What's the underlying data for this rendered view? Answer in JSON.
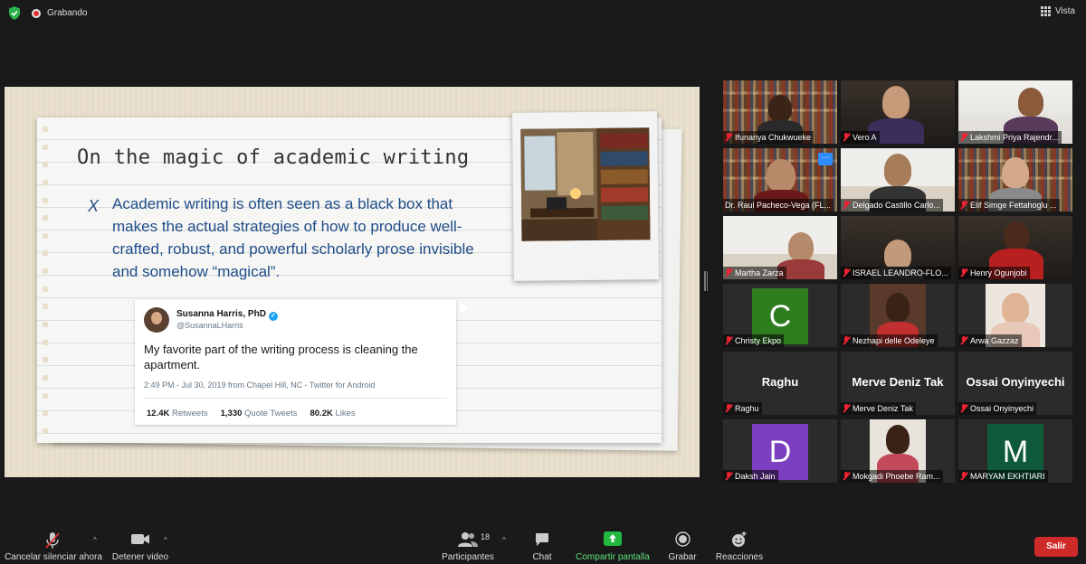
{
  "topbar": {
    "recording_label": "Grabando",
    "view_label": "Vista"
  },
  "slide": {
    "title": "On the magic of academic writing",
    "bullet_marker": "X",
    "bullet_text": "Academic writing is often seen as a black box that makes the actual strategies of how to produce well-crafted, robust, and powerful scholarly prose invisible and somehow “magical”.",
    "tweet": {
      "name": "Susanna Harris, PhD",
      "handle": "@SusannaLHarris",
      "text": "My favorite part of the writing process is cleaning the apartment.",
      "meta": "2:49 PM - Jul 30, 2019 from Chapel Hill, NC - Twitter for Android",
      "retweets_count": "12.4K",
      "retweets_label": "Retweets",
      "quote_count": "1,330",
      "quote_label": "Quote Tweets",
      "likes_count": "80.2K",
      "likes_label": "Likes"
    }
  },
  "participants": [
    {
      "name": "Ifunanya Chukwueke",
      "muted": true
    },
    {
      "name": "Vero A",
      "muted": true
    },
    {
      "name": "Lakshmi Priya Rajendr...",
      "muted": true
    },
    {
      "name": "Dr. Raul Pacheco-Vega (FL...",
      "muted": false,
      "active_speaker": true,
      "more_label": "···"
    },
    {
      "name": "Delgado Castillo Carlo...",
      "muted": true
    },
    {
      "name": "Elif Simge Fettahoglu ...",
      "muted": true
    },
    {
      "name": "Martha Zarza",
      "muted": true
    },
    {
      "name": "ISRAEL LEANDRO-FLO...",
      "muted": true
    },
    {
      "name": "Henry Ogunjobi",
      "muted": true
    },
    {
      "name": "Christy Ekpo",
      "muted": true,
      "initial": "C",
      "color": "#2e7d1f"
    },
    {
      "name": "Nezhapi delle Odeleye",
      "muted": true
    },
    {
      "name": "Arwa Gazzaz",
      "muted": true
    },
    {
      "name": "Raghu",
      "muted": true,
      "display": "Raghu"
    },
    {
      "name": "Merve Deniz Tak",
      "muted": true,
      "display": "Merve Deniz Tak"
    },
    {
      "name": "Ossai Onyinyechi",
      "muted": true,
      "display": "Ossai Onyinyechi"
    },
    {
      "name": "Daksh Jain",
      "muted": true,
      "initial": "D",
      "color": "#7b3fbf"
    },
    {
      "name": "Mokgadi Phoebe Ram...",
      "muted": true
    },
    {
      "name": "MARYAM EKHTIARI",
      "muted": true,
      "initial": "M",
      "color": "#0f5a3a"
    }
  ],
  "toolbar": {
    "mute_label": "Cancelar silenciar ahora",
    "video_label": "Detener video",
    "participants_label": "Participantes",
    "participants_count": "18",
    "chat_label": "Chat",
    "share_label": "Compartir pantalla",
    "record_label": "Grabar",
    "reactions_label": "Reacciones",
    "leave_label": "Salir"
  },
  "colors": {
    "leave_red": "#cf2a2a",
    "share_green": "#23b93f",
    "active_speaker": "#e6dd45",
    "slide_blue_text": "#1f4d8a"
  }
}
